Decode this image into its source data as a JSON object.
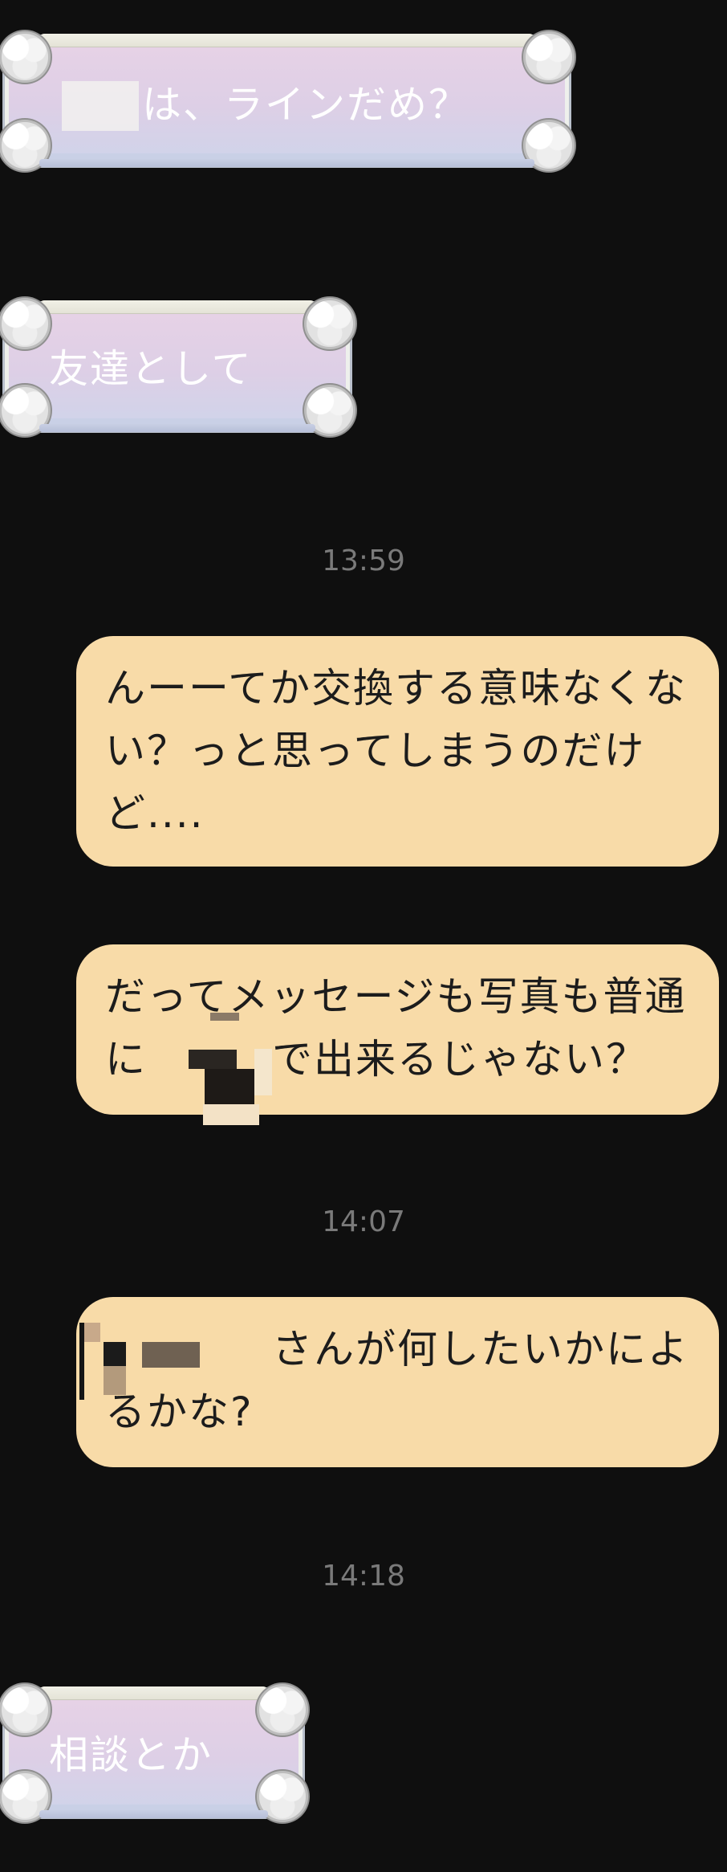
{
  "incoming_messages": [
    {
      "id": "m1",
      "text": "は、ラインだめ？"
    },
    {
      "id": "m2",
      "text": "友達として"
    },
    {
      "id": "m3",
      "text": "相談とか"
    }
  ],
  "timestamps": {
    "t1": "13:59",
    "t2": "14:07",
    "t3": "14:18"
  },
  "outgoing_messages": [
    {
      "id": "o1",
      "text": "んーーてか交換する意味なくない？っと思ってしまうのだけど...."
    },
    {
      "id": "o2",
      "text": "だってメッセージも写真も普通に　　　で出来るじゃない？"
    },
    {
      "id": "o3",
      "text": "　　　　さんが何したいかによるかな?"
    }
  ],
  "colors": {
    "background": "#0f0f0f",
    "outgoing_bubble": "#f8dba8",
    "outgoing_text": "#1c1c1c",
    "incoming_text": "#ffffff",
    "timestamp": "#7a7a7a"
  }
}
